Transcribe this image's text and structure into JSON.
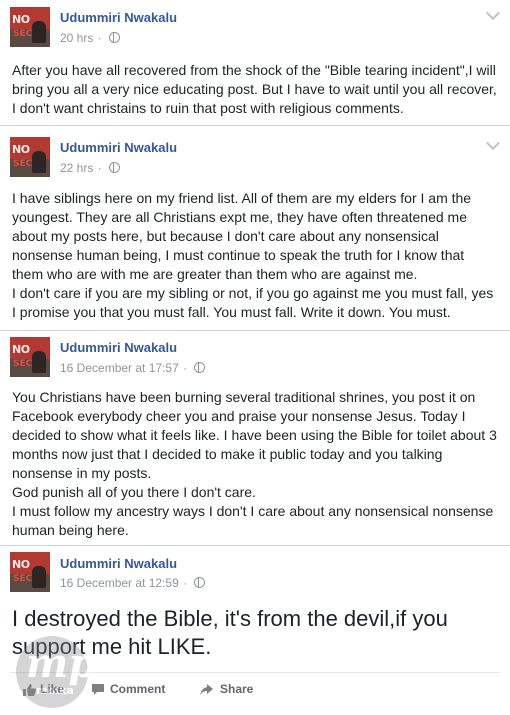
{
  "posts": [
    {
      "author": "Udummiri Nwakalu",
      "time": "20 hrs",
      "separator": "·",
      "text": "After you have all recovered from the shock of the \"Bible tearing incident\",I will bring you all a very nice educating post. But I have to wait until you all recover, I don't want christains to ruin that post with religious comments."
    },
    {
      "author": "Udummiri Nwakalu",
      "time": "22 hrs",
      "separator": "·",
      "text": "I have siblings here on my friend list. All of them are my elders for I am the youngest. They are all Christians expt me, they have often threatened me about my posts here, but because I don't care about any nonsensical nonsense human being, I must continue to speak the truth for I know that them who are with me are greater than them who are against me.\nI don't care if you are my sibling or not, if you go against me you must fall, yes I promise you that you must fall. You must fall. Write it down. You must."
    },
    {
      "author": "Udummiri Nwakalu",
      "time": "16 December at 17:57",
      "separator": "·",
      "text": "You Christians have been burning several traditional shrines, you post it on Facebook everybody cheer you and praise your nonsense Jesus. Today I decided to show what it feels like. I have been using the Bible for toilet about 3 months now just that I decided to make it public today and you talking nonsense in my posts.\nGod punish all of you there I don't care.\nI must follow my ancestry ways I don't I care about any nonsensical nonsense human being here."
    },
    {
      "author": "Udummiri Nwakalu",
      "time": "16 December at 12:59",
      "separator": "·",
      "text": "I destroyed the Bible, it's from the devil,if you support me hit LIKE."
    }
  ],
  "actions": {
    "like": "Like",
    "comment": "Comment",
    "share": "Share"
  },
  "avatar_text": {
    "line1": "NO",
    "line2": "SEC"
  },
  "watermark_text": {
    "brand": "mp",
    "sub": "mo.ka"
  },
  "colors": {
    "name_link": "#365899",
    "meta_gray": "#90949c",
    "body_text": "#1d2129",
    "divider": "#cfd2d6"
  }
}
